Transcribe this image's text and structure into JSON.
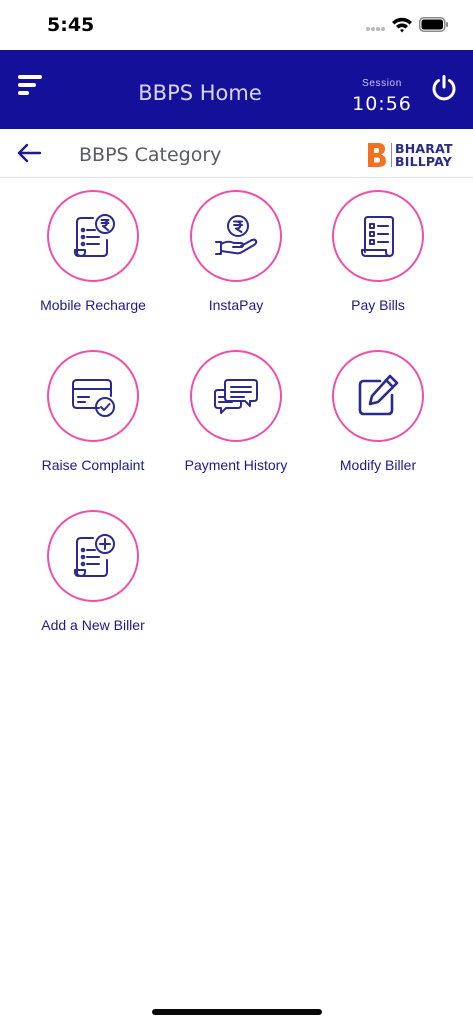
{
  "status_bar": {
    "time": "5:45"
  },
  "header": {
    "title": "BBPS Home",
    "session_label": "Session",
    "session_time": "10:56"
  },
  "subheader": {
    "title": "BBPS Category",
    "logo_line1": "BHARAT",
    "logo_line2": "BILLPAY"
  },
  "colors": {
    "header_bg": "#15109a",
    "tile_border": "#ef4fa6",
    "tile_label": "#1c1a8c",
    "icon_stroke": "#2c2a8e"
  },
  "categories": [
    {
      "label": "Mobile Recharge",
      "icon": "bill-rupee-icon"
    },
    {
      "label": "InstaPay",
      "icon": "rupee-hand-icon"
    },
    {
      "label": "Pay Bills",
      "icon": "bill-list-icon"
    },
    {
      "label": "Raise Complaint",
      "icon": "card-check-icon"
    },
    {
      "label": "Payment History",
      "icon": "chat-bubbles-icon"
    },
    {
      "label": "Modify Biller",
      "icon": "edit-icon"
    },
    {
      "label": "Add a New Biller",
      "icon": "bill-add-icon"
    }
  ]
}
